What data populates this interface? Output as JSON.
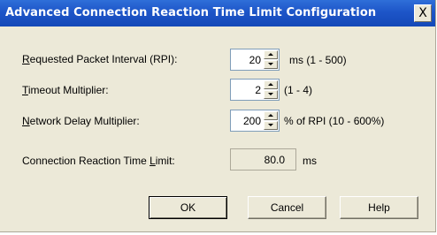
{
  "dialog": {
    "title": "Advanced Connection Reaction Time Limit Configuration",
    "close_label": "X"
  },
  "rows": {
    "rpi": {
      "label_key": "R",
      "label_rest": "equested Packet Interval (RPI):",
      "value": "20",
      "unit": "ms   (1 - 500)"
    },
    "timeout": {
      "label_key": "T",
      "label_rest": "imeout Multiplier:",
      "value": "2",
      "unit": "(1 - 4)"
    },
    "delay": {
      "label_key": "N",
      "label_rest": "etwork Delay Multiplier:",
      "value": "200",
      "unit": "% of RPI (10 - 600%)"
    },
    "limit": {
      "label_pre": "Connection Reaction Time ",
      "label_key": "L",
      "label_rest": "imit:",
      "value": "80.0",
      "unit": "ms"
    }
  },
  "buttons": {
    "ok": "OK",
    "cancel": "Cancel",
    "help": "Help"
  },
  "icons": {
    "spin_up": "spin-up-arrow-icon",
    "spin_down": "spin-down-arrow-icon",
    "close": "close-icon"
  }
}
